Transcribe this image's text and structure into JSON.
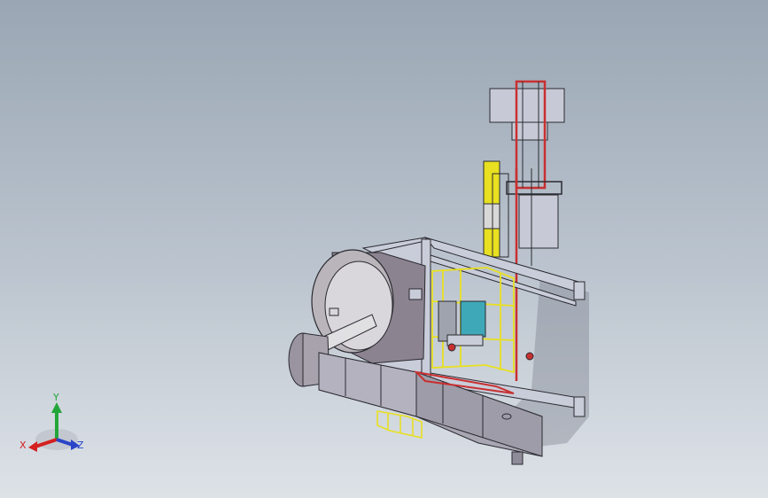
{
  "triad": {
    "x_label": "X",
    "y_label": "Y",
    "z_label": "Z",
    "colors": {
      "x": "#d42020",
      "y": "#22a63a",
      "z": "#2a45c8"
    }
  },
  "model": {
    "colors": {
      "frame_face": "#c9ccd9",
      "frame_edge": "#2a2a30",
      "drum_body": "#8c8390",
      "drum_inner": "#d9d6dc",
      "guard": "#e8e020",
      "highlight": "#c83030",
      "panel": "#3fa8b8",
      "dark": "#4a4a52"
    }
  }
}
